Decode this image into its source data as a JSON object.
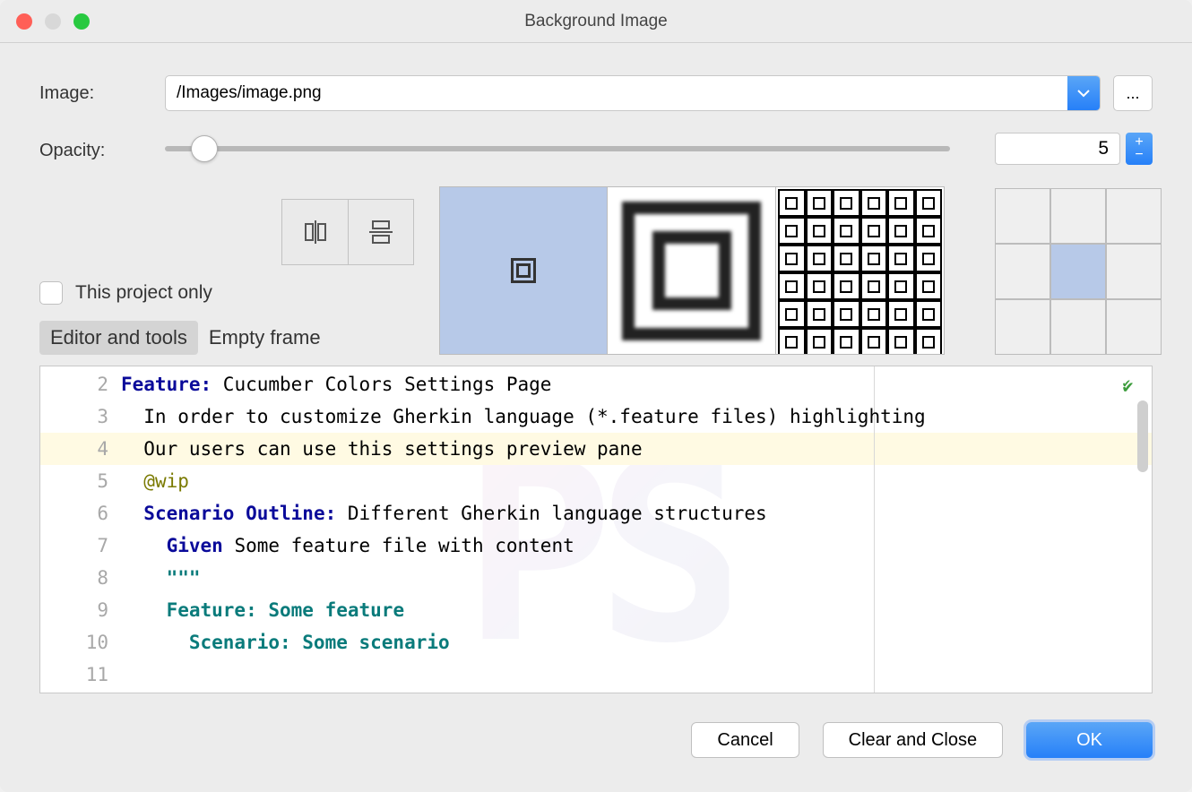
{
  "window": {
    "title": "Background Image"
  },
  "image": {
    "label": "Image:",
    "path": "/Images/image.png",
    "browse": "..."
  },
  "opacity": {
    "label": "Opacity:",
    "value": "5"
  },
  "project_only": {
    "label": "This project only",
    "checked": false
  },
  "tabs": {
    "editor": "Editor and tools",
    "empty": "Empty frame",
    "active": "editor"
  },
  "anchor": {
    "selected": 4
  },
  "editor": {
    "line_numbers": [
      "2",
      "3",
      "4",
      "5",
      "6",
      "7",
      "8",
      "9",
      "10",
      "11"
    ],
    "lines": [
      {
        "parts": [
          {
            "t": "Feature:",
            "c": "kw"
          },
          {
            "t": " Cucumber Colors Settings Page"
          }
        ]
      },
      {
        "parts": [
          {
            "t": "  In order to customize Gherkin language (*.feature files) highlighting"
          }
        ]
      },
      {
        "parts": [
          {
            "t": "  Our users can use this settings preview pane"
          }
        ],
        "hl": true
      },
      {
        "parts": [
          {
            "t": ""
          }
        ]
      },
      {
        "parts": [
          {
            "t": "  "
          },
          {
            "t": "@wip",
            "c": "tag-annot"
          }
        ]
      },
      {
        "parts": [
          {
            "t": "  "
          },
          {
            "t": "Scenario Outline:",
            "c": "kw"
          },
          {
            "t": " Different Gherkin language structures"
          }
        ]
      },
      {
        "parts": [
          {
            "t": "    "
          },
          {
            "t": "Given",
            "c": "kw"
          },
          {
            "t": " Some feature file with content"
          }
        ]
      },
      {
        "parts": [
          {
            "t": "    "
          },
          {
            "t": "\"\"\"",
            "c": "str"
          }
        ]
      },
      {
        "parts": [
          {
            "t": "    "
          },
          {
            "t": "Feature: Some feature",
            "c": "str"
          }
        ]
      },
      {
        "parts": [
          {
            "t": "      "
          },
          {
            "t": "Scenario: Some scenario",
            "c": "str"
          }
        ]
      }
    ]
  },
  "buttons": {
    "cancel": "Cancel",
    "clear": "Clear and Close",
    "ok": "OK"
  }
}
